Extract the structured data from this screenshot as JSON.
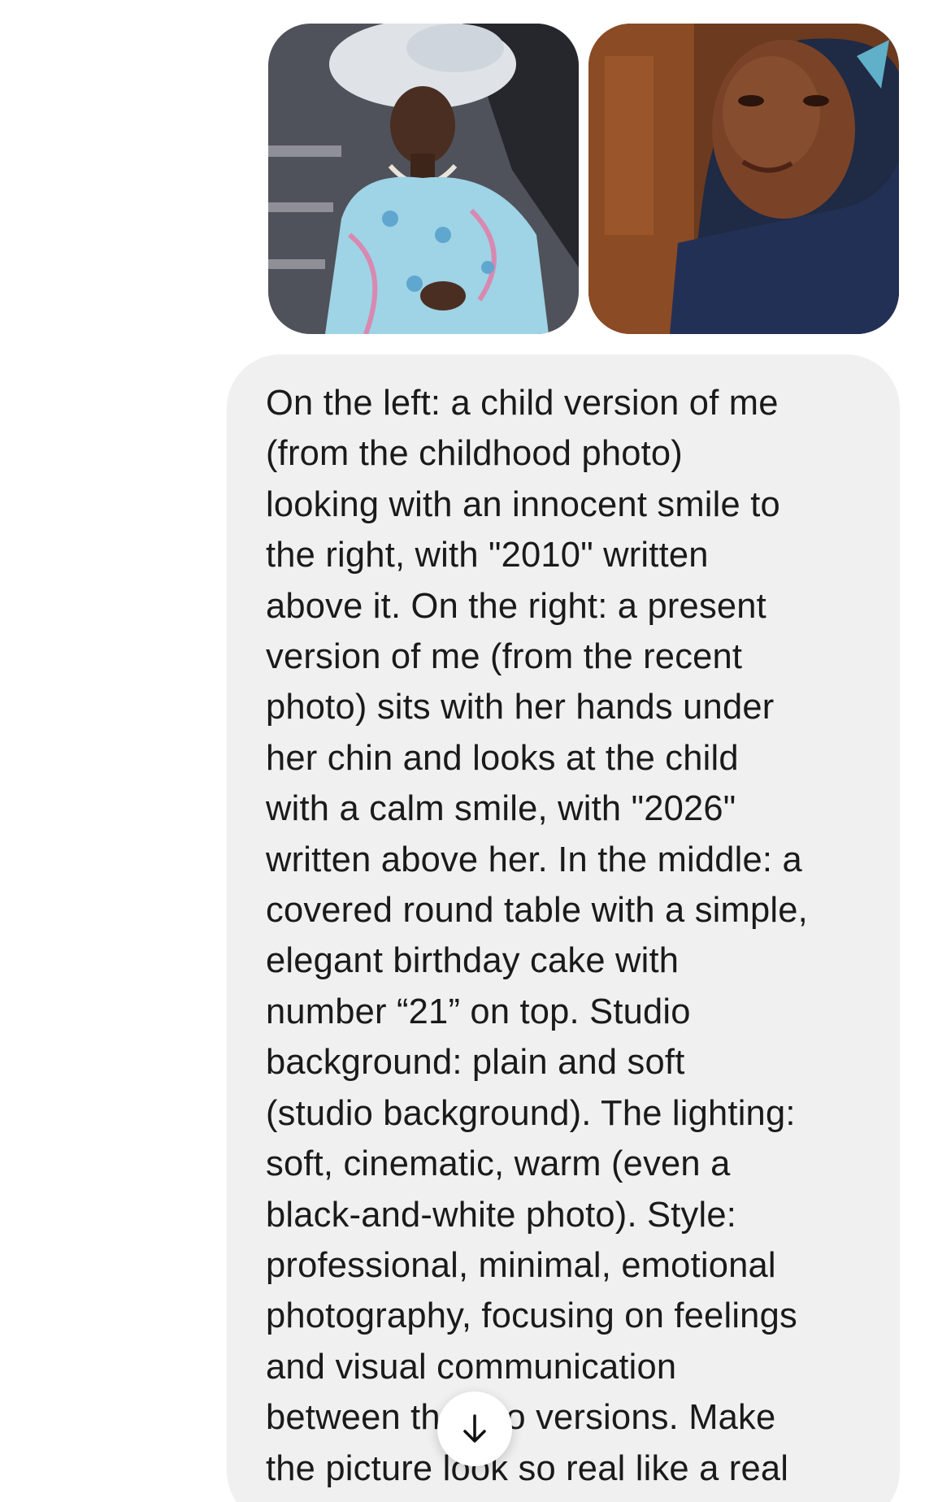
{
  "attachments": [
    {
      "icon": "childhood-photo"
    },
    {
      "icon": "recent-photo"
    }
  ],
  "message": {
    "lines": [
      "On the left: a child version of me",
      "(from the childhood photo)",
      "looking with an innocent smile to",
      "the right, with \"2010\" written",
      "above it. On the right: a present",
      "version of me (from the recent",
      "photo) sits with her hands under",
      "her chin and looks at the child",
      "with a calm smile, with \"2026\"",
      "written above her. In the middle: a",
      "covered round table with a simple,",
      "elegant birthday cake with",
      "number “21” on top. Studio",
      "background: plain and soft",
      "(studio background). The lighting:",
      "soft, cinematic, warm (even a",
      "black-and-white photo). Style:",
      "professional, minimal, emotional",
      "photography, focusing on feelings",
      "and visual communication",
      "between the two versions. Make",
      "the picture look so real like a real"
    ]
  },
  "scroll_button": {
    "icon": "arrow-down-icon"
  },
  "colors": {
    "bubble_bg": "#f0f0f0",
    "text": "#1a1a1a",
    "page_bg": "#ffffff"
  }
}
